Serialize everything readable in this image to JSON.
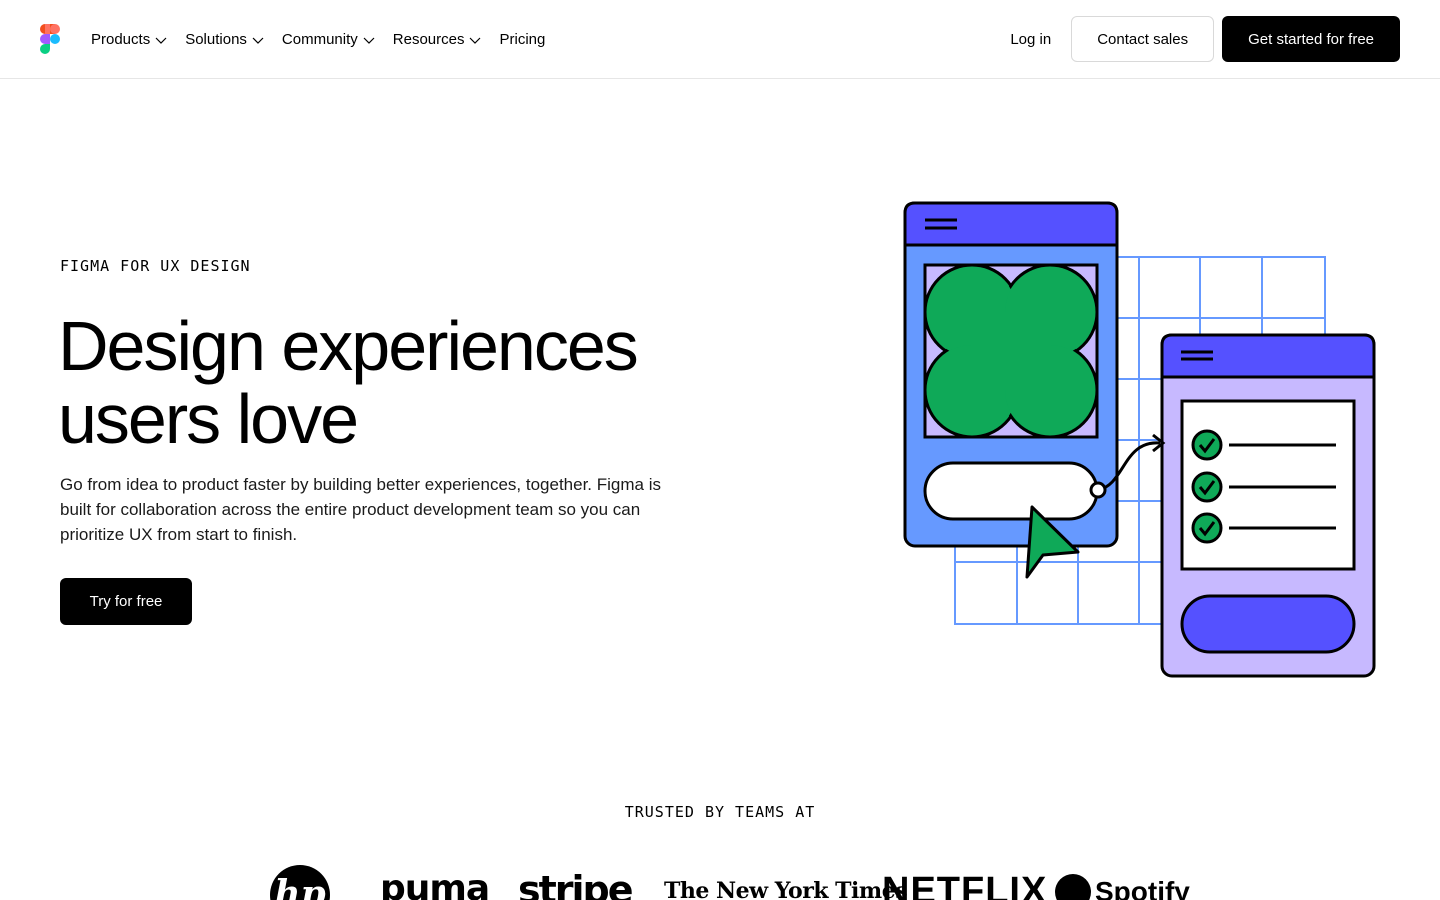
{
  "header": {
    "nav": [
      {
        "label": "Products",
        "has_dropdown": true
      },
      {
        "label": "Solutions",
        "has_dropdown": true
      },
      {
        "label": "Community",
        "has_dropdown": true
      },
      {
        "label": "Resources",
        "has_dropdown": true
      },
      {
        "label": "Pricing",
        "has_dropdown": false
      }
    ],
    "login_label": "Log in",
    "contact_label": "Contact sales",
    "get_started_label": "Get started for free"
  },
  "hero": {
    "eyebrow": "FIGMA FOR UX DESIGN",
    "title_line1": "Design experiences",
    "title_line2": "users love",
    "description": "Go from idea to product faster by building better experiences, together. Figma is built for collaboration across the entire product development team so you can prioritize UX from start to finish.",
    "cta_label": "Try for free"
  },
  "trusted": {
    "heading": "TRUSTED BY TEAMS AT",
    "brands": [
      "hp",
      "puma",
      "stripe",
      "The New York Times",
      "NETFLIX",
      "Spotify"
    ]
  },
  "colors": {
    "accent_blue": "#5551ff",
    "light_blue": "#6699ff",
    "lavender": "#c7b9ff",
    "green": "#0fa958",
    "black": "#000000"
  }
}
